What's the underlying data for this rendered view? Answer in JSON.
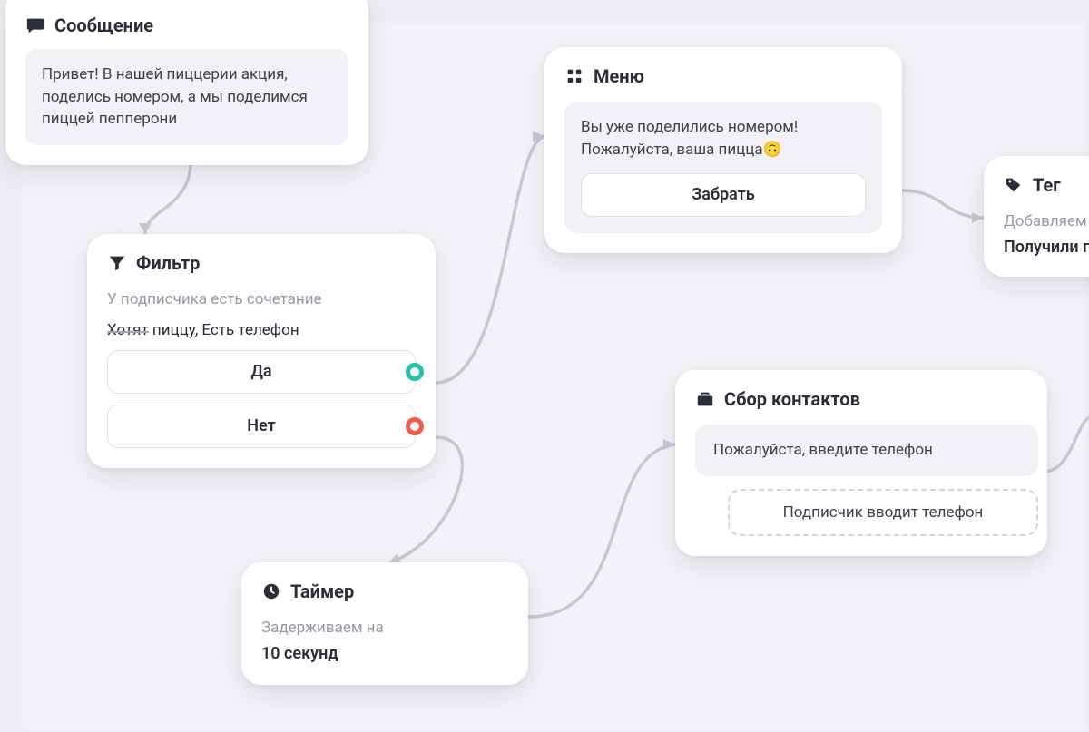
{
  "message": {
    "title": "Сообщение",
    "body": "Привет! В нашей пиццерии акция, поделись номером, а мы поделимся пиццей пепперони"
  },
  "filter": {
    "title": "Фильтр",
    "desc": "У подписчика есть сочетание",
    "tag_strike": "Хотят",
    "tag_rest": "пиццу, Есть телефон",
    "yes": "Да",
    "no": "Нет"
  },
  "timer": {
    "title": "Таймер",
    "desc": "Задерживаем на",
    "value": "10 секунд"
  },
  "menu": {
    "title": "Меню",
    "body": "Вы уже поделились номером! Пожалуйста, ваша пицца🙃",
    "button": "Забрать"
  },
  "collect": {
    "title": "Сбор контактов",
    "prompt": "Пожалуйста, введите телефон",
    "user_action": "Подписчик вводит телефон"
  },
  "tag": {
    "title": "Тег",
    "desc": "Добавляем",
    "value": "Получили пи"
  }
}
